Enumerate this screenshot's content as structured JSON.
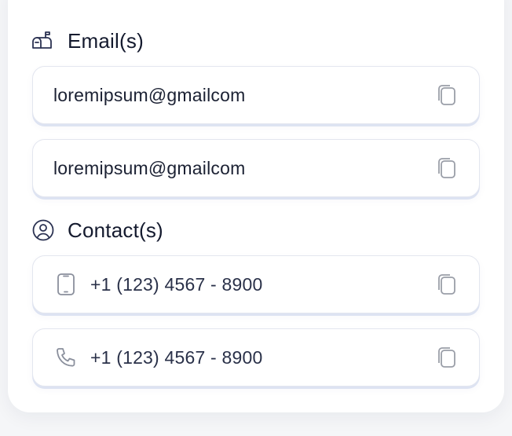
{
  "sections": {
    "emails": {
      "title": "Email(s)",
      "icon": "mailbox-icon",
      "items": [
        {
          "value": "loremipsum@gmailcom",
          "action_icon": "copy-icon"
        },
        {
          "value": "loremipsum@gmailcom",
          "action_icon": "copy-icon"
        }
      ]
    },
    "contacts": {
      "title": "Contact(s)",
      "icon": "user-circle-icon",
      "items": [
        {
          "value": "+1 (123) 4567 - 8900",
          "icon": "mobile-phone-icon",
          "action_icon": "copy-icon"
        },
        {
          "value": "+1 (123) 4567 - 8900",
          "icon": "phone-icon",
          "action_icon": "copy-icon"
        }
      ]
    }
  },
  "colors": {
    "text_primary": "#141a2e",
    "icon_muted": "#9a9ea8",
    "field_border": "#e3e6ef",
    "field_shadow": "#dde3f2"
  }
}
